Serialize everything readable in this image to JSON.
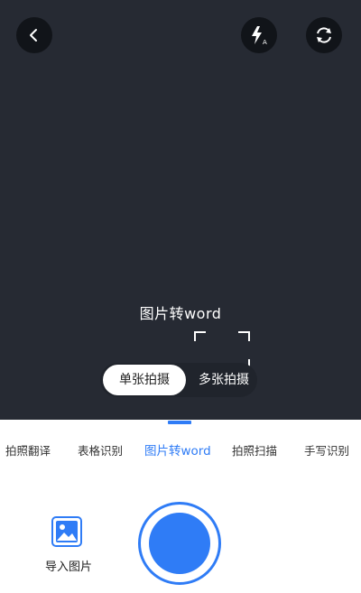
{
  "header": {
    "back_icon": "chevron-left-icon",
    "flash_icon": "flash-auto-icon",
    "switch_icon": "camera-switch-icon"
  },
  "viewfinder": {
    "mode_title": "图片转word"
  },
  "capture_mode": {
    "single": "单张拍摄",
    "multi": "多张拍摄",
    "selected": "单张拍摄"
  },
  "tabs": [
    {
      "label": "拍照翻译"
    },
    {
      "label": "表格识别"
    },
    {
      "label": "图片转word"
    },
    {
      "label": "拍照扫描"
    },
    {
      "label": "手写识别"
    }
  ],
  "active_tab": "图片转word",
  "bottom": {
    "import_label": "导入图片",
    "import_icon": "image-icon"
  },
  "colors": {
    "accent": "#2f7cf6",
    "camera_bg": "#262a33"
  }
}
